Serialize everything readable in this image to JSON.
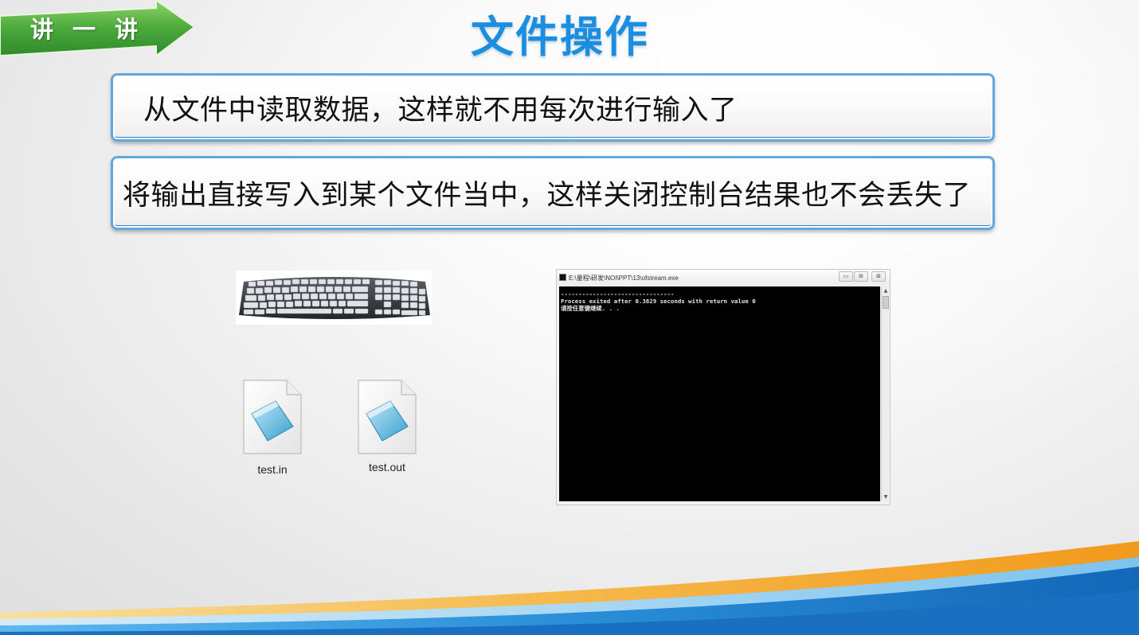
{
  "badge": {
    "chars": [
      "讲",
      "一",
      "讲"
    ]
  },
  "title": "文件操作",
  "bullets": [
    "从文件中读取数据，这样就不用每次进行输入了",
    "将输出直接写入到某个文件当中，这样关闭控制台结果也不会丢失了"
  ],
  "files": [
    {
      "name": "test.in",
      "icon": "notepad-file-icon"
    },
    {
      "name": "test.out",
      "icon": "notepad-file-icon"
    }
  ],
  "console": {
    "title": "E:\\量程\\研发\\NOI\\PPT\\13\\ofstream.exe",
    "lines": [
      "--------------------------------",
      "Process exited after 0.3829 seconds with return value 0",
      "请按任意键继续. . ."
    ],
    "buttons": {
      "minimize": "▭",
      "maximize": "⊞",
      "close": "⊠"
    }
  },
  "colors": {
    "title": "#1a8ee0",
    "badge_green": "#4caa3c",
    "box_border": "#5fa9df",
    "swoosh_blue": "#1e78c8",
    "swoosh_orange": "#f5a623"
  }
}
